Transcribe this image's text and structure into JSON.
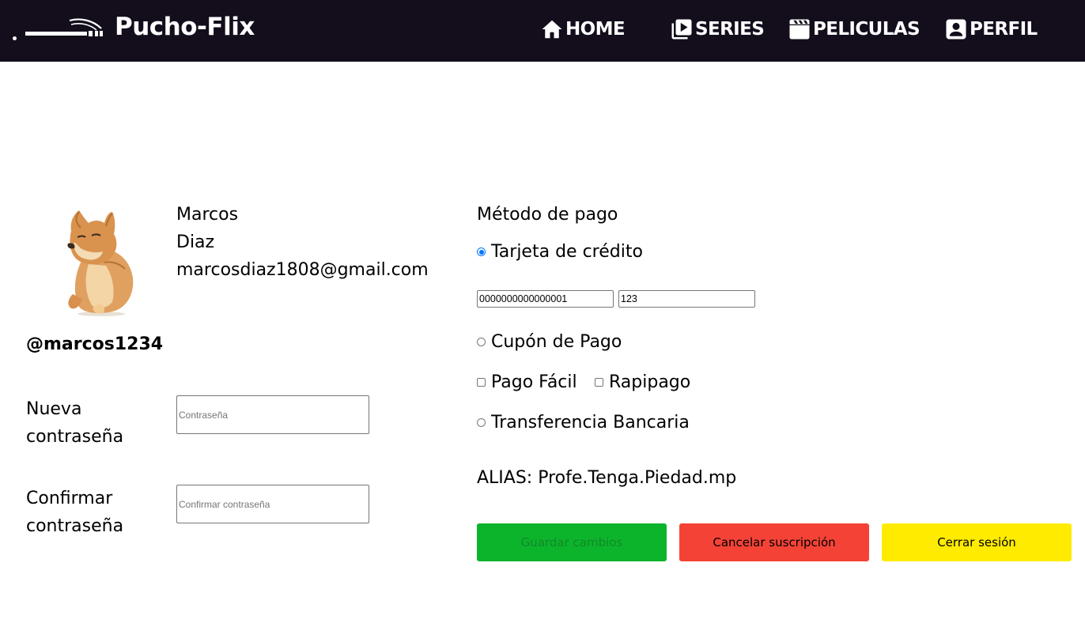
{
  "navbar": {
    "brand": "Pucho-Flix",
    "items": [
      {
        "label": "HOME",
        "icon": "home-icon"
      },
      {
        "label": "SERIES",
        "icon": "series-play-icon"
      },
      {
        "label": "PELICULAS",
        "icon": "clapperboard-icon"
      },
      {
        "label": "PERFIL",
        "icon": "profile-icon"
      }
    ]
  },
  "profile": {
    "first_name": "Marcos",
    "last_name": "Diaz",
    "email": "marcosdiaz1808@gmail.com",
    "username": "@marcos1234",
    "new_password_label": "Nueva contraseña",
    "new_password_placeholder": "Contraseña",
    "confirm_password_label": "Confirmar contraseña",
    "confirm_password_placeholder": "Confirmar contraseña"
  },
  "payment": {
    "title": "Método de pago",
    "credit_card_label": "Tarjeta de crédito",
    "card_number": "0000000000000001",
    "card_cvv": "123",
    "coupon_label": "Cupón de Pago",
    "pago_facil_label": "Pago Fácil",
    "rapipago_label": "Rapipago",
    "transfer_label": "Transferencia Bancaria",
    "alias": "ALIAS: Profe.Tenga.Piedad.mp",
    "selected": "Tarjeta de crédito"
  },
  "buttons": {
    "save": "Guardar cambios",
    "cancel_subscription": "Cancelar suscripción",
    "logout": "Cerrar sesión"
  },
  "colors": {
    "navbar_bg": "#130d1c",
    "save_bg": "#0cb42c",
    "cancel_bg": "#f44336",
    "logout_bg": "#ffeb00",
    "radio_accent": "#0075ff"
  }
}
